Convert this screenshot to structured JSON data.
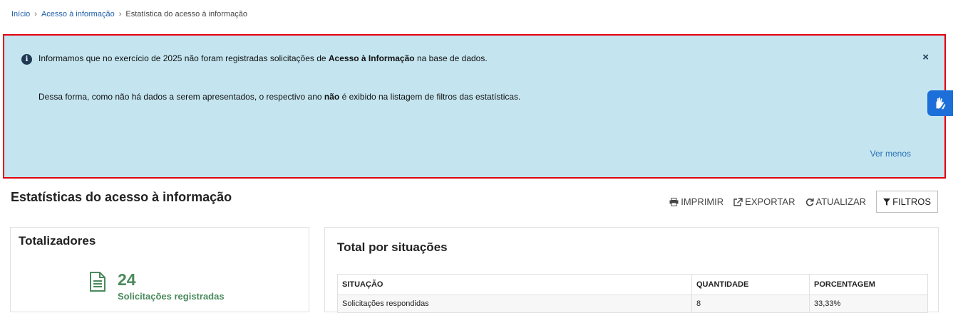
{
  "breadcrumb": {
    "home": "Início",
    "section": "Acesso à informação",
    "current": "Estatística do acesso à informação"
  },
  "alert": {
    "line1_pre": "Informamos que no exercício de 2025 não foram registradas solicitações de ",
    "line1_bold": "Acesso à Informação",
    "line1_post": " na base de dados.",
    "line2_pre": "Dessa forma, como não há dados a serem apresentados, o respectivo ano ",
    "line2_bold": "não",
    "line2_post": " é exibido na listagem de filtros das estatísticas.",
    "toggle_label": "Ver menos",
    "close_glyph": "×",
    "colors": {
      "background": "#c4e5f0",
      "border": "#e3000f"
    }
  },
  "page": {
    "title": "Estatísticas do acesso à informação"
  },
  "toolbar": {
    "print": "IMPRIMIR",
    "export": "EXPORTAR",
    "refresh": "ATUALIZAR",
    "filters": "FILTROS"
  },
  "totalizadores": {
    "title": "Totalizadores",
    "count": "24",
    "label": "Solicitações registradas",
    "accent": "#4a8a5c"
  },
  "situacoes": {
    "title": "Total por situações",
    "columns": [
      "SITUAÇÃO",
      "QUANTIDADE",
      "PORCENTAGEM"
    ],
    "rows": [
      [
        "Solicitações respondidas",
        "8",
        "33,33%"
      ]
    ]
  },
  "icons": [
    "info-icon",
    "close-icon",
    "print-icon",
    "export-icon",
    "refresh-icon",
    "filter-icon",
    "document-icon",
    "sign-language-icon"
  ]
}
